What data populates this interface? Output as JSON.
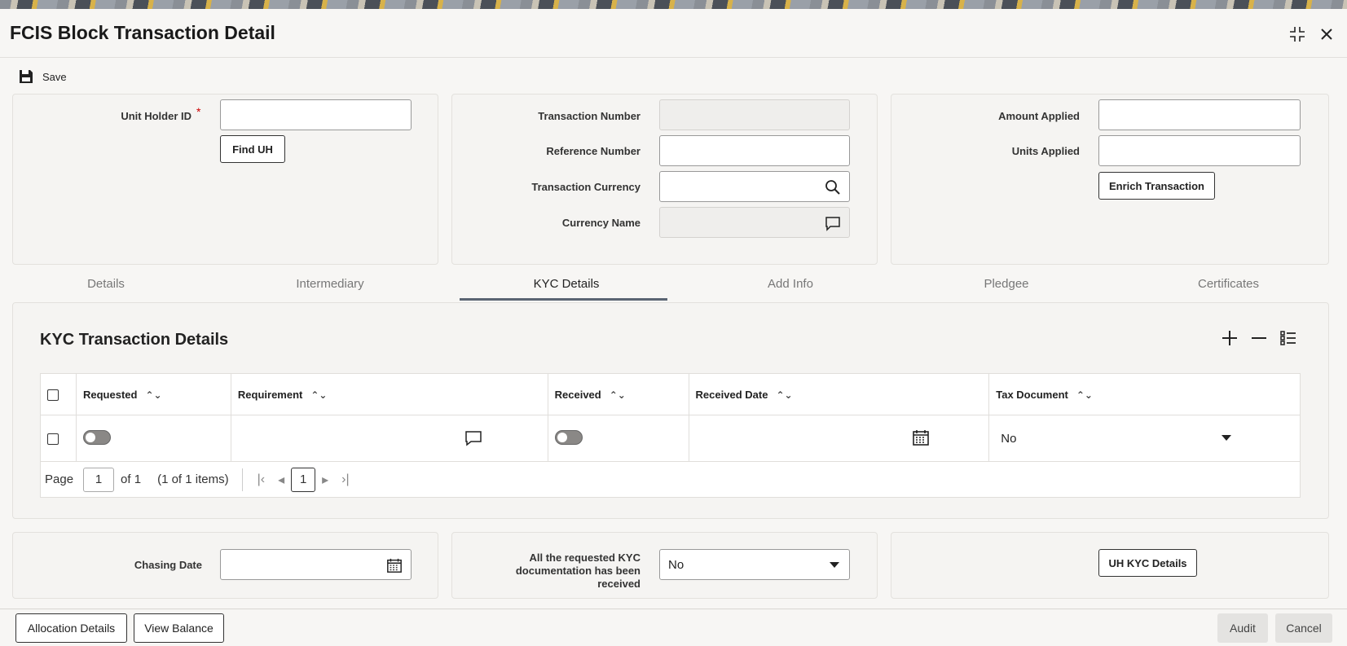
{
  "window": {
    "title": "FCIS Block Transaction Detail"
  },
  "toolbar": {
    "save_label": "Save"
  },
  "header": {
    "unit_holder_id_label": "Unit Holder ID",
    "unit_holder_id_value": "",
    "required_marker": "*",
    "find_uh_label": "Find UH",
    "transaction_number_label": "Transaction Number",
    "transaction_number_value": "",
    "reference_number_label": "Reference Number",
    "reference_number_value": "",
    "transaction_currency_label": "Transaction Currency",
    "transaction_currency_value": "",
    "currency_name_label": "Currency Name",
    "currency_name_value": "",
    "amount_applied_label": "Amount Applied",
    "amount_applied_value": "",
    "units_applied_label": "Units Applied",
    "units_applied_value": "",
    "enrich_transaction_label": "Enrich Transaction"
  },
  "tabs": [
    {
      "label": "Details",
      "active": false
    },
    {
      "label": "Intermediary",
      "active": false
    },
    {
      "label": "KYC Details",
      "active": true
    },
    {
      "label": "Add Info",
      "active": false
    },
    {
      "label": "Pledgee",
      "active": false
    },
    {
      "label": "Certificates",
      "active": false
    }
  ],
  "kyc": {
    "section_title": "KYC Transaction Details",
    "columns": [
      "Requested",
      "Requirement",
      "Received",
      "Received Date",
      "Tax Document"
    ],
    "rows": [
      {
        "requested": false,
        "requirement": "",
        "received": false,
        "received_date": "",
        "tax_document": "No"
      }
    ],
    "pager": {
      "page_label": "Page",
      "page_value": "1",
      "of_label": "of 1",
      "items_label": "(1 of 1 items)",
      "current_page": "1"
    }
  },
  "footer_panel": {
    "chasing_date_label": "Chasing Date",
    "chasing_date_value": "",
    "all_received_label": "All the requested KYC documentation has been received",
    "all_received_value": "No",
    "uh_kyc_details_label": "UH KYC Details"
  },
  "bottom": {
    "allocation_details_label": "Allocation Details",
    "view_balance_label": "View Balance",
    "audit_label": "Audit",
    "cancel_label": "Cancel"
  }
}
